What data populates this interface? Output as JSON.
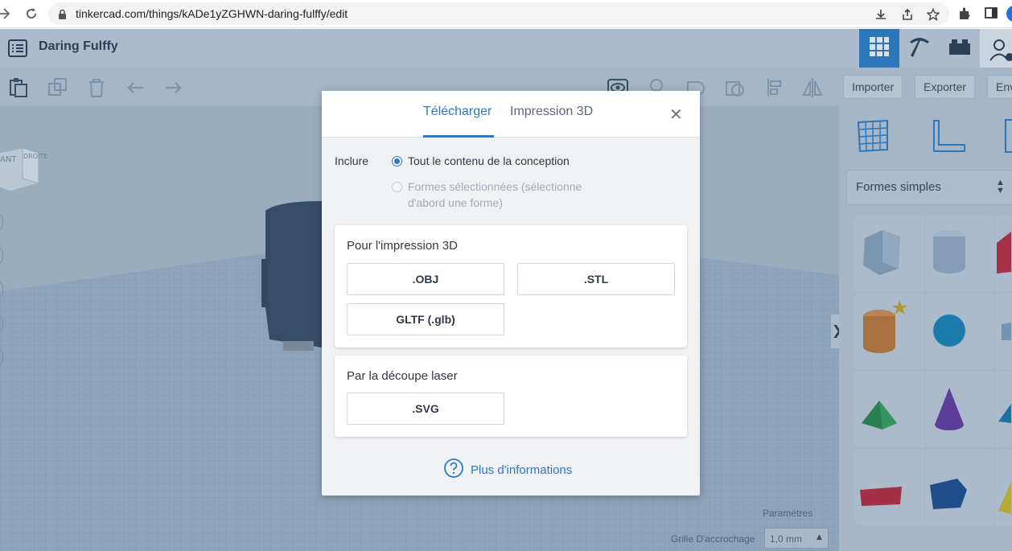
{
  "browser": {
    "url": "tinkercad.com/things/kADe1yZGHWN-daring-fulffy/edit"
  },
  "app": {
    "title": "Daring Fulffy"
  },
  "toolbar": {
    "import_label": "Importer",
    "export_label": "Exporter",
    "send_label": "Env"
  },
  "viewcube": {
    "front": "ANT",
    "right": "DROITE"
  },
  "sidebar": {
    "shape_category": "Formes simples"
  },
  "footer": {
    "settings_label": "Paramètres",
    "snap_label": "Grille D'accrochage",
    "snap_value": "1,0 mm"
  },
  "modal": {
    "tabs": [
      {
        "label": "Télécharger",
        "active": true
      },
      {
        "label": "Impression 3D",
        "active": false
      }
    ],
    "include_label": "Inclure",
    "option_all": "Tout le contenu de la conception",
    "option_selected_line1": "Formes sélectionnées (sélectionne",
    "option_selected_line2": "d'abord une forme)",
    "section_3d_title": "Pour l'impression 3D",
    "format_obj": ".OBJ",
    "format_stl": ".STL",
    "format_gltf": "GLTF (.glb)",
    "section_laser_title": "Par la découpe laser",
    "format_svg": ".SVG",
    "more_info": "Plus d'informations"
  },
  "colors": {
    "accent": "#2d78c4",
    "header_bg": "#c9d4dd",
    "active_view": "#2e7fc9"
  }
}
